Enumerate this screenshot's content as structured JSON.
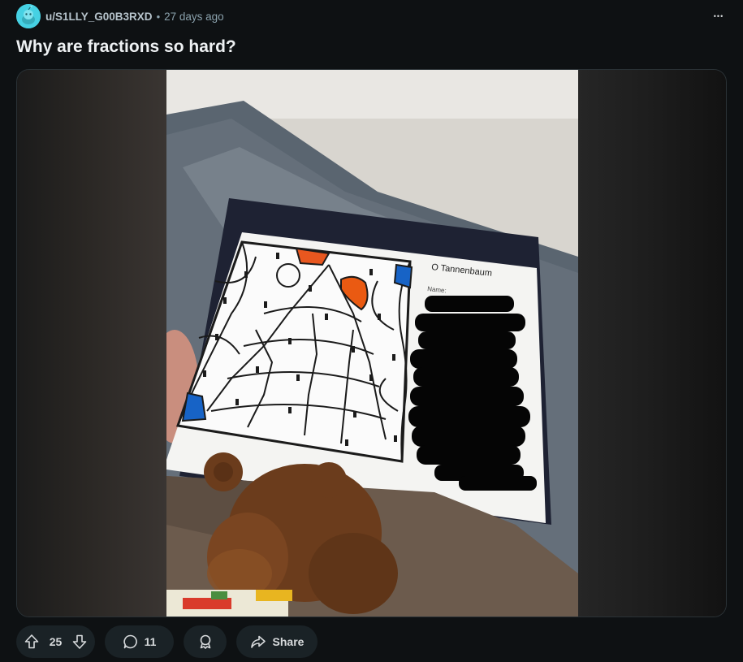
{
  "post": {
    "username": "u/S1LLY_G00B3RXD",
    "separator": "•",
    "timestamp": "27 days ago",
    "more_label": "•••",
    "title": "Why are fractions so hard?"
  },
  "image": {
    "worksheet_title": "O Tannenbaum",
    "name_label": "Name:"
  },
  "actions": {
    "vote_count": "25",
    "comment_count": "11",
    "share_label": "Share"
  },
  "icons": {
    "avatar": "snoo-avatar-icon",
    "more": "more-options-icon",
    "upvote": "upvote-arrow-icon",
    "downvote": "downvote-arrow-icon",
    "comment": "comment-bubble-icon",
    "award": "award-icon",
    "share": "share-arrow-icon"
  },
  "colors": {
    "background": "#0e1113",
    "avatar": "#46d1e3",
    "pill": "#1a2226",
    "muted_text": "#8ba2ad"
  }
}
